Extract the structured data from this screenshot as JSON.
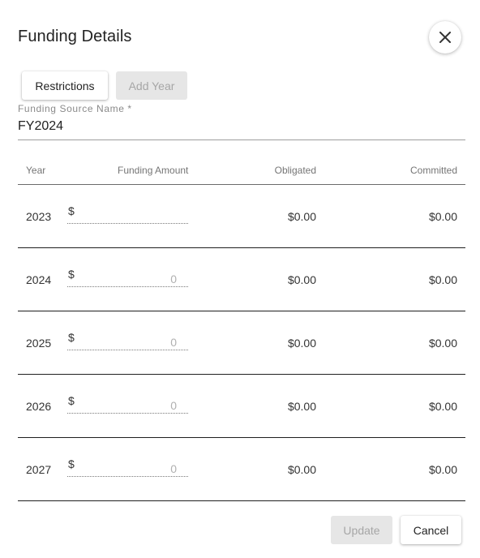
{
  "dialog": {
    "title": "Funding Details",
    "close_icon": "close-icon"
  },
  "toolbar": {
    "restrictions_label": "Restrictions",
    "add_year_label": "Add Year"
  },
  "funding_source": {
    "label": "Funding Source Name *",
    "value": "FY2024"
  },
  "table": {
    "headers": {
      "year": "Year",
      "funding_amount": "Funding Amount",
      "obligated": "Obligated",
      "committed": "Committed"
    },
    "rows": [
      {
        "year": "2023",
        "currency": "$",
        "amount_placeholder": "",
        "obligated": "$0.00",
        "committed": "$0.00"
      },
      {
        "year": "2024",
        "currency": "$",
        "amount_placeholder": "0",
        "obligated": "$0.00",
        "committed": "$0.00"
      },
      {
        "year": "2025",
        "currency": "$",
        "amount_placeholder": "0",
        "obligated": "$0.00",
        "committed": "$0.00"
      },
      {
        "year": "2026",
        "currency": "$",
        "amount_placeholder": "0",
        "obligated": "$0.00",
        "committed": "$0.00"
      },
      {
        "year": "2027",
        "currency": "$",
        "amount_placeholder": "0",
        "obligated": "$0.00",
        "committed": "$0.00"
      }
    ]
  },
  "footer": {
    "update_label": "Update",
    "cancel_label": "Cancel"
  }
}
